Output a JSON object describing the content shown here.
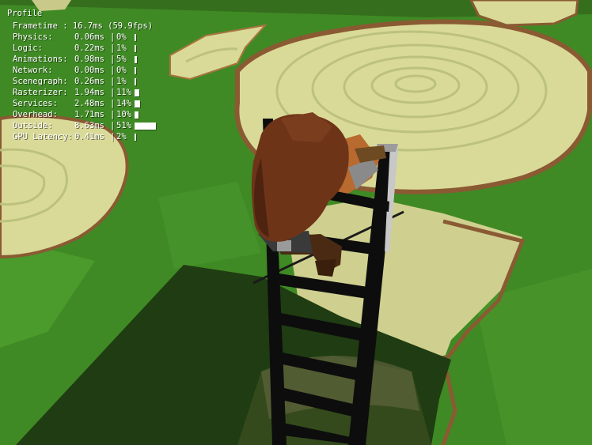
{
  "profile": {
    "title": "Profile",
    "frametime_label": "Frametime :",
    "frametime_value": "16.7ms (59.9fps)",
    "separator": "|",
    "rows": [
      {
        "label": "Physics:",
        "ms": "0.06ms",
        "pct": "0%",
        "fraction": 0.0
      },
      {
        "label": "Logic:",
        "ms": "0.22ms",
        "pct": "1%",
        "fraction": 0.01
      },
      {
        "label": "Animations:",
        "ms": "0.98ms",
        "pct": "5%",
        "fraction": 0.05
      },
      {
        "label": "Network:",
        "ms": "0.00ms",
        "pct": "0%",
        "fraction": 0.0
      },
      {
        "label": "Scenegraph:",
        "ms": "0.26ms",
        "pct": "1%",
        "fraction": 0.01
      },
      {
        "label": "Rasterizer:",
        "ms": "1.94ms",
        "pct": "11%",
        "fraction": 0.11
      },
      {
        "label": "Services:",
        "ms": "2.48ms",
        "pct": "14%",
        "fraction": 0.14
      },
      {
        "label": "Overhead:",
        "ms": "1.71ms",
        "pct": "10%",
        "fraction": 0.1
      },
      {
        "label": "Outside:",
        "ms": "8.63ms",
        "pct": "51%",
        "fraction": 0.51
      },
      {
        "label": "GPU Latency:",
        "ms": "0.41ms",
        "pct": "2%",
        "fraction": 0.02
      }
    ]
  },
  "scene": {
    "colors": {
      "grass": "#3f8a24",
      "grass_dark": "#2f6d1a",
      "stump_top": "#d9da98",
      "stump_ring": "#bcc27d",
      "stump_bark": "#8a5a33",
      "ladder": "#0d0d0d",
      "ladder_edge": "#c8c8c8",
      "hair": "#6e3418",
      "skin": "#b86a2f",
      "cloth": "#2a2a2a",
      "shadow": "#1e3a12"
    }
  }
}
